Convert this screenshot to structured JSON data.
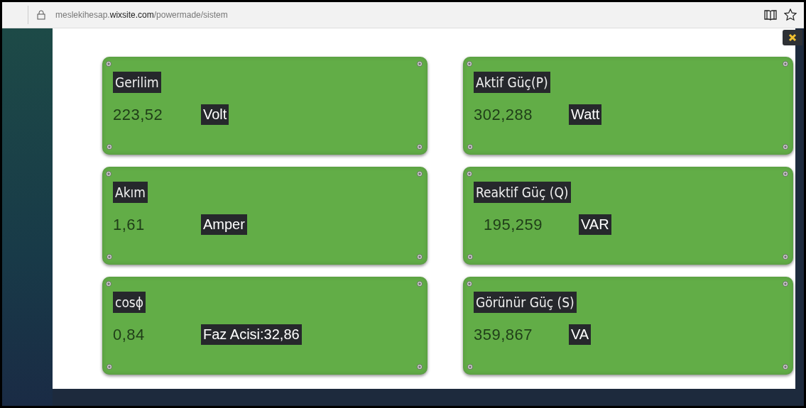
{
  "browser": {
    "url_host": "meslekihesap.",
    "url_domain": "wixsite.com",
    "url_path": "/powermade/sistem"
  },
  "cards": [
    {
      "title": "Gerilim",
      "value": "223,52",
      "unit": "Volt"
    },
    {
      "title": "Aktif Güç(P)",
      "value": "302,288",
      "unit": "Watt"
    },
    {
      "title": "Akım",
      "value": "1,61",
      "unit": "Amper"
    },
    {
      "title": "Reaktif Güç (Q)",
      "value": "195,259",
      "unit": "VAR"
    },
    {
      "title": "cosϕ",
      "value": "0,84",
      "unit": "Faz Acisi:32,86"
    },
    {
      "title": "Görünür Güç (S)",
      "value": "359,867",
      "unit": "VA"
    }
  ]
}
